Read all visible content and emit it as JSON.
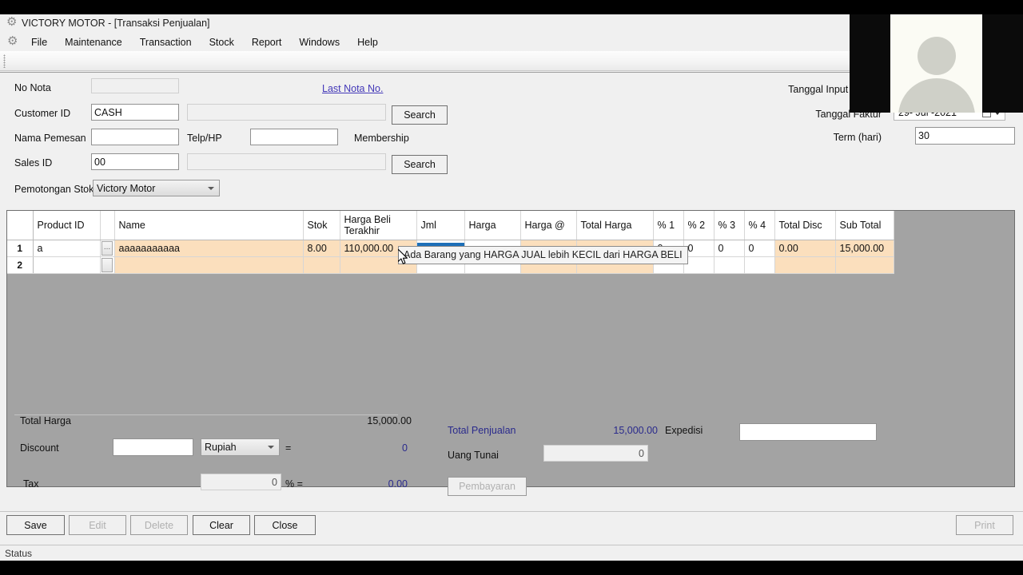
{
  "window": {
    "title": "VICTORY MOTOR - [Transaksi Penjualan]",
    "app_icon": "gear-icon"
  },
  "menubar": {
    "icon": "gear-icon",
    "items": [
      "File",
      "Maintenance",
      "Transaction",
      "Stock",
      "Report",
      "Windows",
      "Help"
    ]
  },
  "form": {
    "no_nota_label": "No Nota",
    "no_nota_value": "",
    "last_nota_link": "Last Nota No.",
    "customer_id_label": "Customer ID",
    "customer_id_value": "CASH",
    "customer_name_value": "",
    "customer_search_label": "Search",
    "nama_pemesan_label": "Nama Pemesan",
    "nama_pemesan_value": "",
    "telp_label": "Telp/HP",
    "telp_value": "",
    "membership_label": "Membership",
    "sales_id_label": "Sales ID",
    "sales_id_value": "00",
    "sales_name_value": "",
    "sales_search_label": "Search",
    "pemotongan_stok_label": "Pemotongan Stok",
    "pemotongan_stok_value": "Victory Motor",
    "pemotongan_stok_options": [
      "Victory Motor"
    ],
    "tanggal_input_label": "Tanggal Input Pe",
    "tanggal_faktur_label": "Tanggal Faktur",
    "tanggal_faktur_value": "29- Jul -2021",
    "term_label": "Term (hari)",
    "term_value": "30"
  },
  "grid": {
    "columns": [
      "",
      "Product ID",
      "",
      "Name",
      "Stok",
      "Harga Beli Terakhir",
      "Jml",
      "Harga",
      "Harga @",
      "Total Harga",
      "% 1",
      "% 2",
      "% 3",
      "% 4",
      "Total Disc",
      "Sub Total"
    ],
    "ellipsis_label": "...",
    "rows": [
      {
        "no": "1",
        "product_id": "a",
        "name": "aaaaaaaaaaa",
        "stok": "8.00",
        "harga_beli_terakhir": "110,000.00",
        "jml": "",
        "harga": "",
        "harga_at": "",
        "total_harga": "",
        "pct1": "0",
        "pct2": "0",
        "pct3": "0",
        "pct4": "0",
        "total_disc": "0.00",
        "sub_total": "15,000.00"
      },
      {
        "no": "2",
        "product_id": "",
        "name": "",
        "stok": "",
        "harga_beli_terakhir": "",
        "jml": "",
        "harga": "",
        "harga_at": "",
        "total_harga": "",
        "pct1": "",
        "pct2": "",
        "pct3": "",
        "pct4": "",
        "total_disc": "",
        "sub_total": ""
      }
    ]
  },
  "tooltip": {
    "text": "Ada Barang yang HARGA JUAL lebih KECIL dari HARGA BELI"
  },
  "totals": {
    "total_harga_label": "Total Harga",
    "total_harga_value": "15,000.00",
    "discount_label": "Discount",
    "discount_value": "",
    "discount_type": "Rupiah",
    "discount_type_options": [
      "Rupiah"
    ],
    "discount_eq": "=",
    "discount_result": "0",
    "tax_label": "Tax",
    "tax_value": "0",
    "tax_pct": "% =",
    "tax_result": "0.00",
    "total_penjualan_label": "Total Penjualan",
    "total_penjualan_value": "15,000.00",
    "uang_tunai_label": "Uang Tunai",
    "uang_tunai_value": "0",
    "pembayaran_label": "Pembayaran",
    "expedisi_label": "Expedisi",
    "expedisi_value": ""
  },
  "footer": {
    "save_label": "Save",
    "edit_label": "Edit",
    "delete_label": "Delete",
    "clear_label": "Clear",
    "close_label": "Close",
    "print_label": "Print",
    "status_label": "Status"
  },
  "colors": {
    "accent_link": "#4338b8",
    "grid_readonly": "#fbdfbd",
    "grid_selection": "#1d6fb8",
    "grid_background": "#a3a3a3",
    "form_background": "#f0f0f0"
  }
}
